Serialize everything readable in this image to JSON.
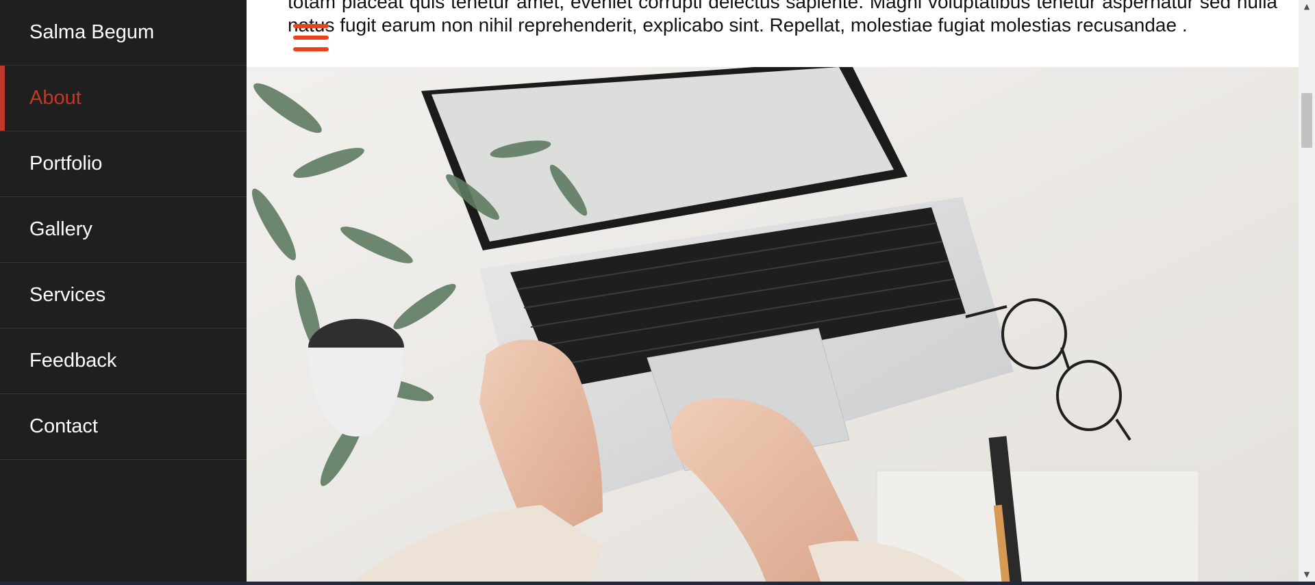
{
  "sidebar": {
    "brand": "Salma Begum",
    "items": [
      {
        "label": "About",
        "active": true
      },
      {
        "label": "Portfolio",
        "active": false
      },
      {
        "label": "Gallery",
        "active": false
      },
      {
        "label": "Services",
        "active": false
      },
      {
        "label": "Feedback",
        "active": false
      },
      {
        "label": "Contact",
        "active": false
      }
    ]
  },
  "main": {
    "paragraph": "totam placeat quis tenetur amet, eveniet corrupti delectus sapiente. Magni voluptatibus tenetur aspernatur sed nulla natus fugit earum non nihil reprehenderit, explicabo sint. Repellat, molestiae fugiat molestias recusandae .",
    "menu_icon": "hamburger-menu-icon"
  },
  "colors": {
    "sidebar_bg": "#1f1f1f",
    "accent": "#c0392b",
    "hamburger": "#e8431b"
  }
}
